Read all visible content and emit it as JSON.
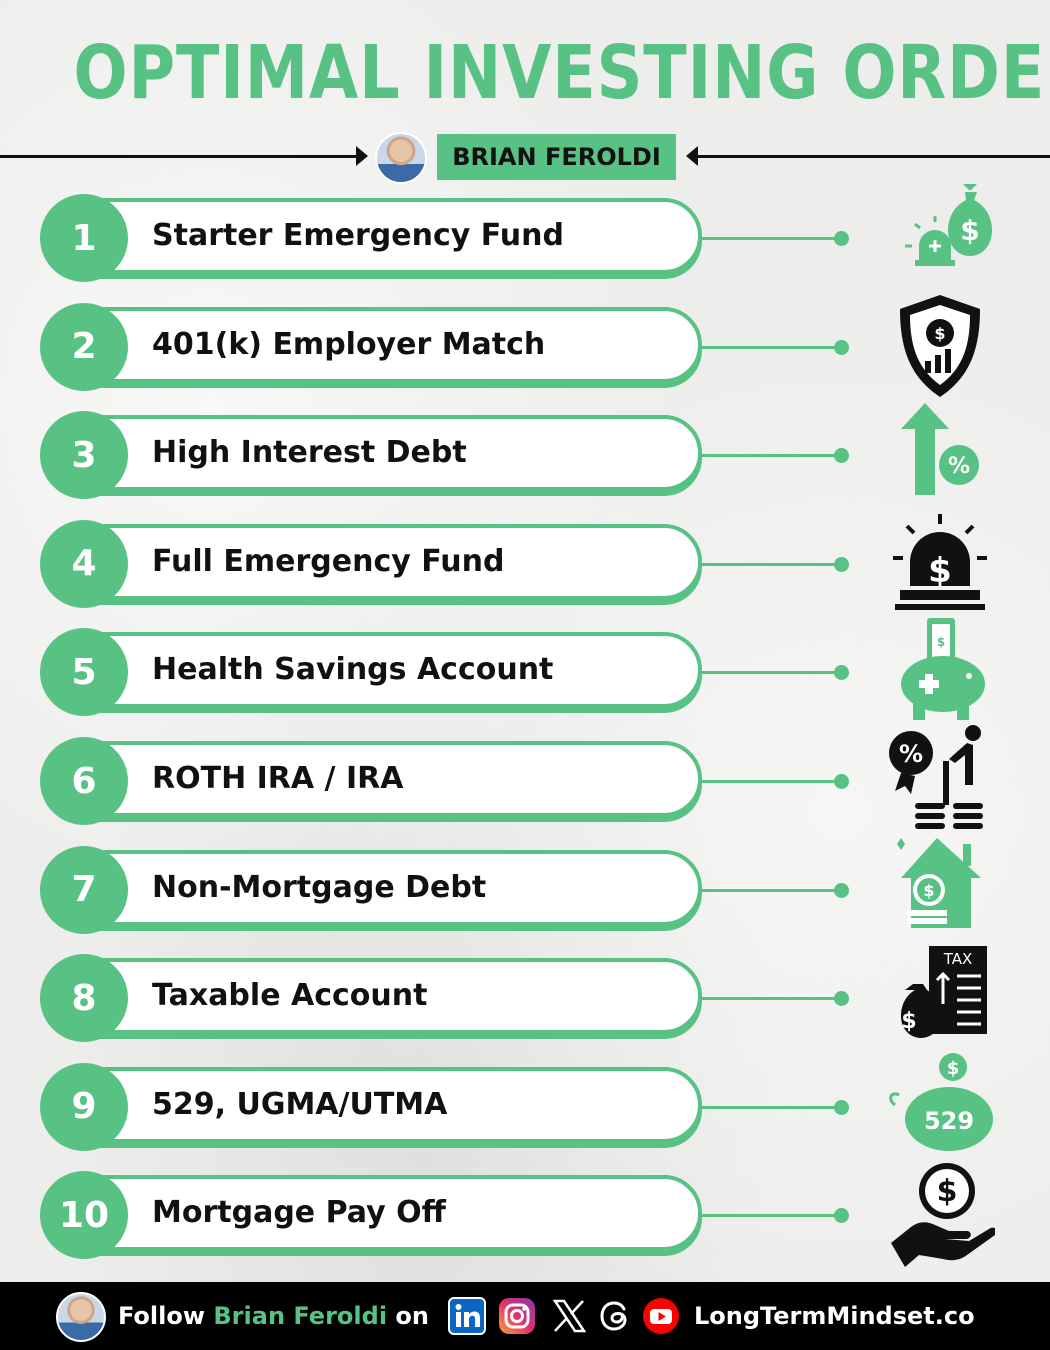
{
  "title": "OPTIMAL INVESTING ORDER",
  "author": {
    "name": "BRIAN FEROLDI"
  },
  "accent_color": "#57c283",
  "steps": [
    {
      "number": "1",
      "label": "Starter Emergency Fund",
      "icon": "money-bag-siren-icon"
    },
    {
      "number": "2",
      "label": "401(k) Employer Match",
      "icon": "shield-dollar-chart-icon"
    },
    {
      "number": "3",
      "label": "High Interest Debt",
      "icon": "arrow-up-percent-icon"
    },
    {
      "number": "4",
      "label": "Full Emergency Fund",
      "icon": "dollar-siren-icon"
    },
    {
      "number": "5",
      "label": "Health Savings Account",
      "icon": "piggy-bank-medical-icon"
    },
    {
      "number": "6",
      "label": "ROTH IRA / IRA",
      "icon": "percent-badge-retiree-coins-icon"
    },
    {
      "number": "7",
      "label": "Non-Mortgage Debt",
      "icon": "house-coins-icon"
    },
    {
      "number": "8",
      "label": "Taxable Account",
      "icon": "tax-document-money-bag-icon"
    },
    {
      "number": "9",
      "label": "529, UGMA/UTMA",
      "icon": "piggy-bank-529-icon"
    },
    {
      "number": "10",
      "label": "Mortgage Pay Off",
      "icon": "hand-dollar-coin-icon"
    }
  ],
  "footer": {
    "follow_prefix": "Follow",
    "name": "Brian Feroldi",
    "follow_suffix": "on",
    "socials": [
      "linkedin-icon",
      "instagram-icon",
      "x-icon",
      "threads-icon",
      "youtube-icon"
    ],
    "website": "LongTermMindset.co"
  }
}
